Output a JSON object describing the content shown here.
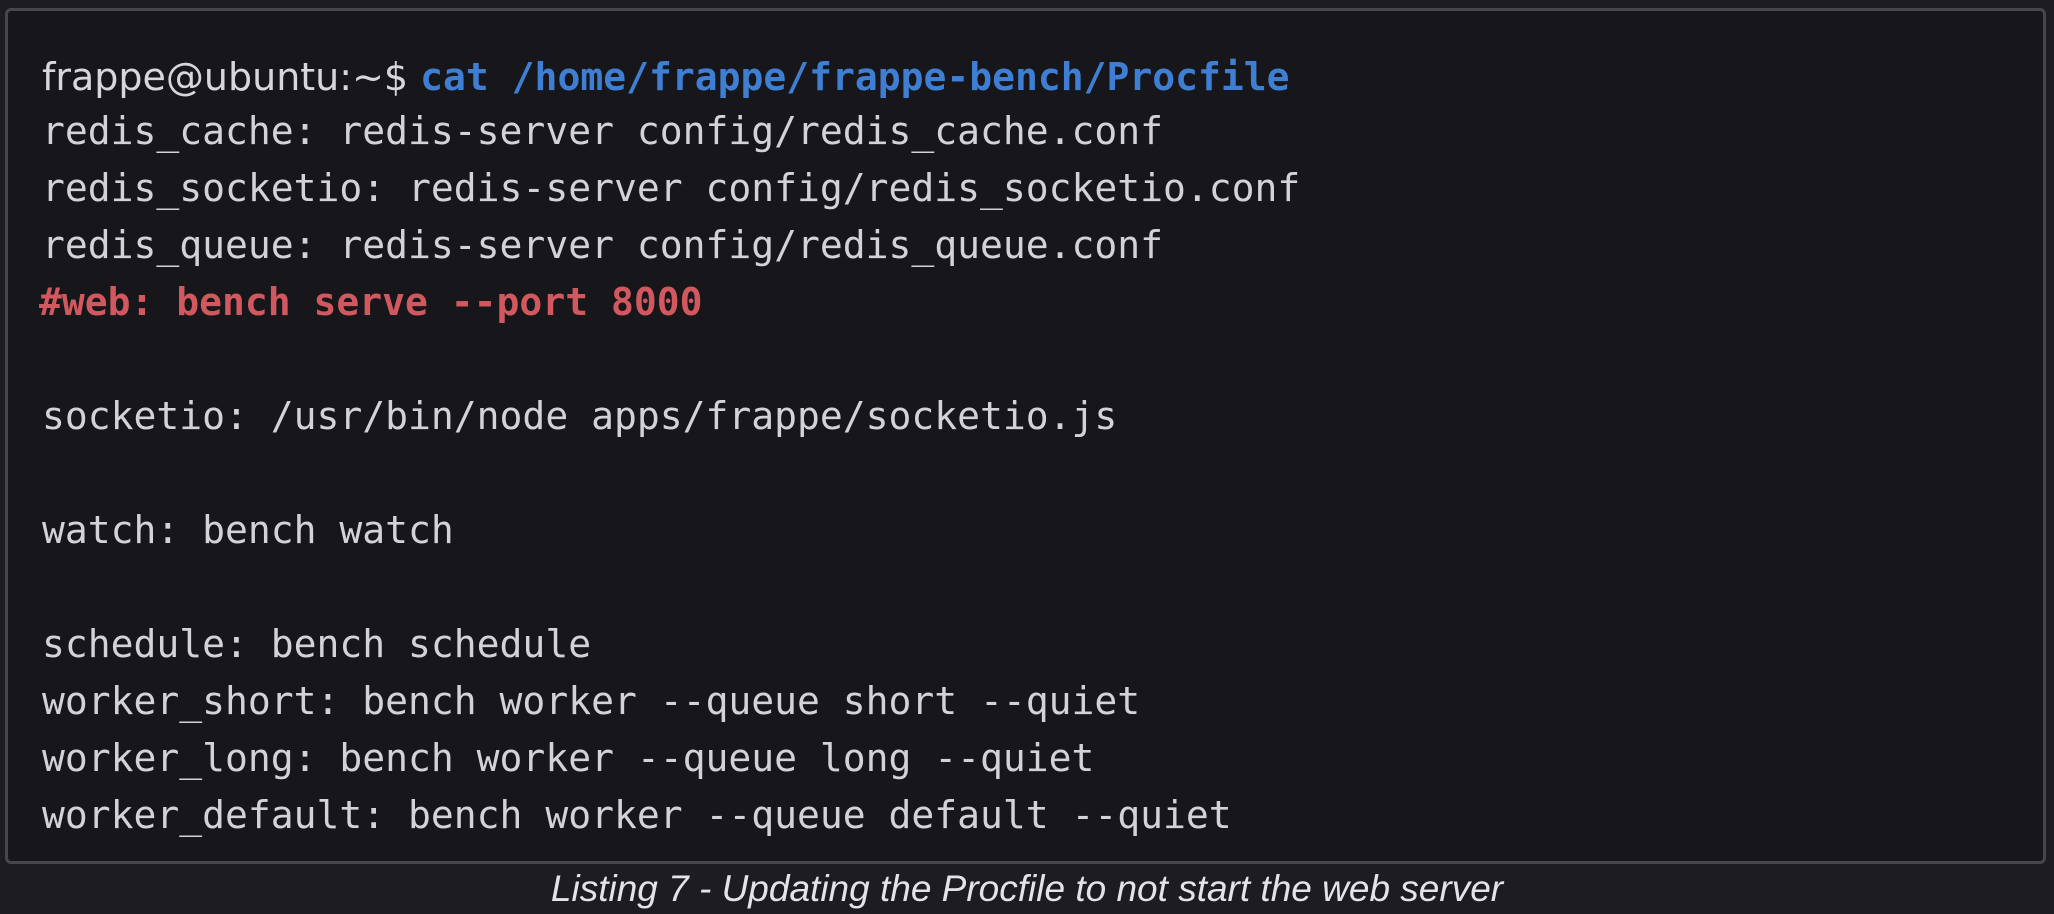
{
  "terminal": {
    "prompt": "frappe@ubuntu:~$ ",
    "command": "cat /home/frappe/frappe-bench/Procfile",
    "lines": [
      "redis_cache: redis-server config/redis_cache.conf",
      "redis_socketio: redis-server config/redis_socketio.conf",
      "redis_queue: redis-server config/redis_queue.conf",
      "#web: bench serve --port 8000",
      "socketio: /usr/bin/node apps/frappe/socketio.js",
      "watch: bench watch",
      "schedule: bench schedule",
      "worker_short: bench worker --queue short --quiet",
      "worker_long: bench worker --queue long --quiet",
      "worker_default: bench worker --queue default --quiet"
    ]
  },
  "caption": "Listing 7 - Updating the Procfile to not start the web server",
  "colors": {
    "background": "#1c1c21",
    "terminal_background": "#17171b",
    "border": "#46464c",
    "text": "#d2d2d8",
    "command": "#3f7fd3",
    "comment": "#d1585e"
  }
}
